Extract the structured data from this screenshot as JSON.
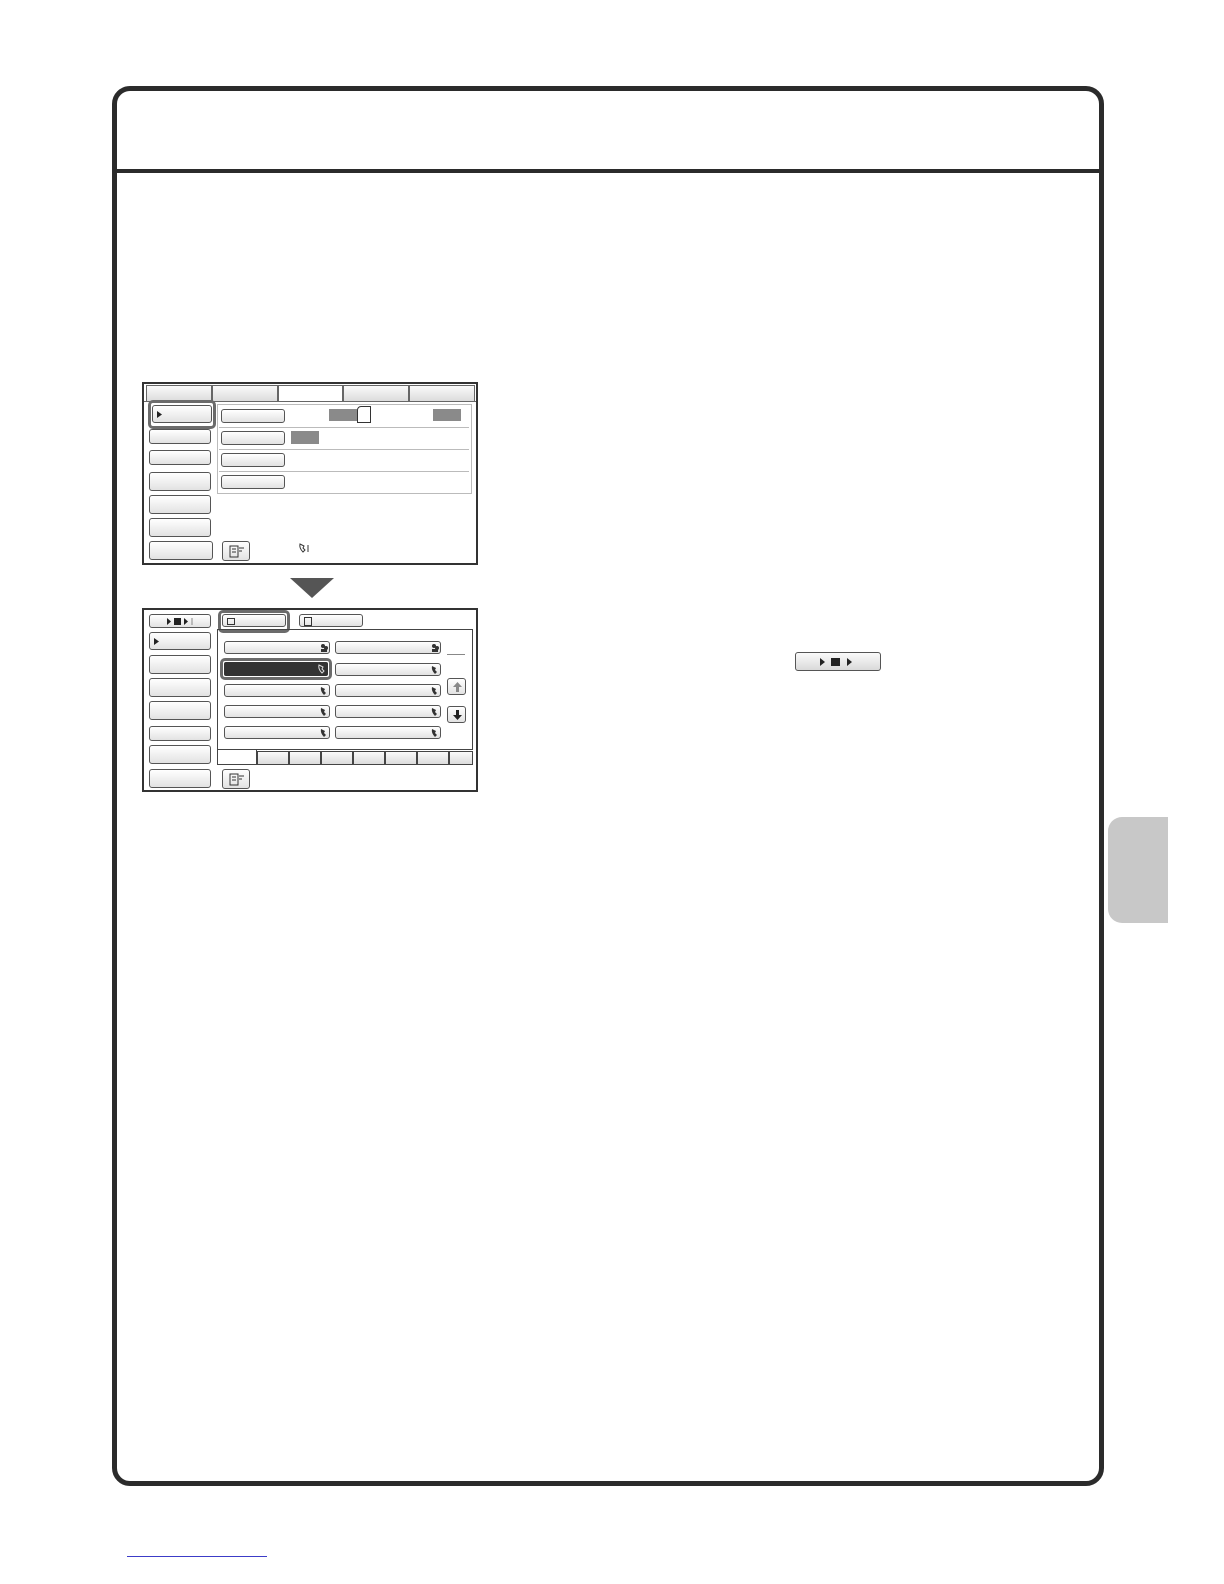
{
  "icons": {
    "play": "play-icon",
    "stop": "stop-icon",
    "phone": "phone-icon",
    "group": "group-icon",
    "scroll_up": "arrow-up-icon",
    "scroll_down": "arrow-down-icon",
    "job": "job-status-icon",
    "folder": "folder-icon",
    "doc": "document-icon"
  },
  "colors": {
    "frame": "#2b2b2b",
    "side_tab": "#c8c8c8",
    "footer_link": "#3c3cc8"
  }
}
